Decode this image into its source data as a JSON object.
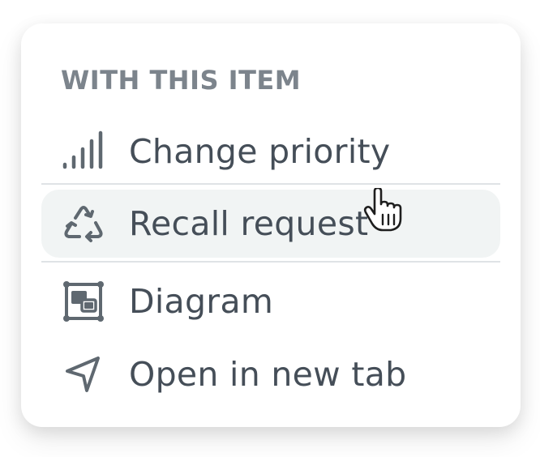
{
  "menu": {
    "section_heading": "WITH THIS ITEM",
    "items": [
      {
        "label": "Change priority",
        "icon": "signal-bars-icon",
        "hovered": false
      },
      {
        "label": "Recall request",
        "icon": "recycle-icon",
        "hovered": true
      },
      {
        "label": "Diagram",
        "icon": "diagram-icon",
        "hovered": false
      },
      {
        "label": "Open in new tab",
        "icon": "navigation-arrow-icon",
        "hovered": false
      }
    ]
  },
  "colors": {
    "text": "#454e58",
    "heading": "#7c848c",
    "icon": "#5f6870",
    "hover_background": "#f1f4f4",
    "divider": "#dfe3e6"
  },
  "cursor": {
    "icon": "hand-pointer-icon"
  }
}
